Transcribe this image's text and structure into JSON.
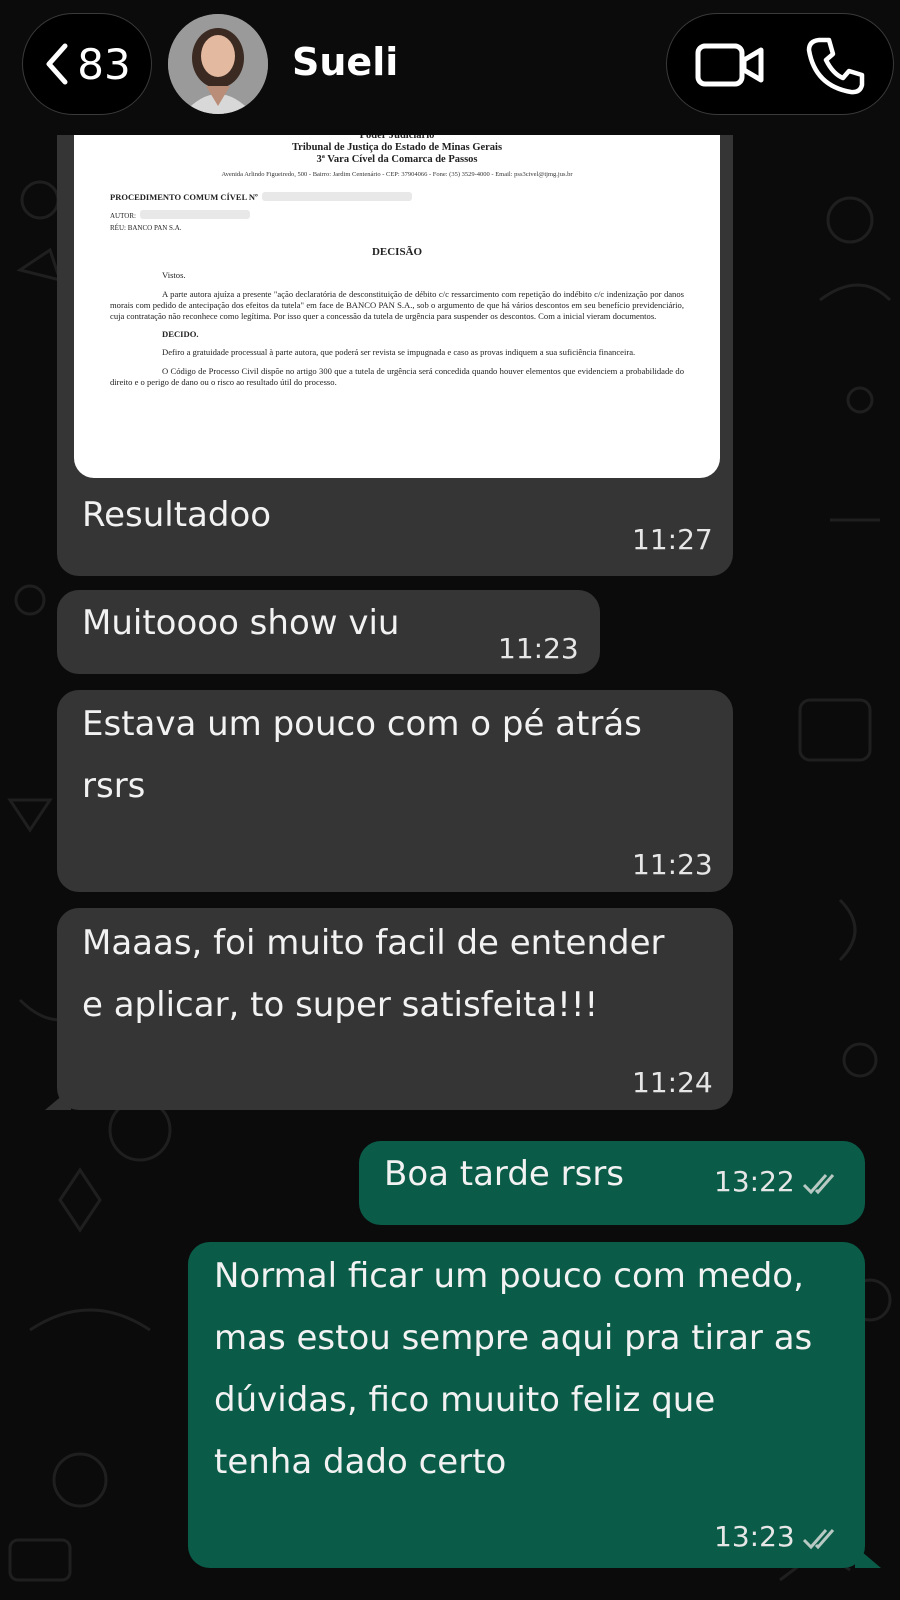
{
  "header": {
    "back_count": "83",
    "contact_name": "Sueli"
  },
  "document": {
    "line1": "Poder Judiciário",
    "line2": "Tribunal de Justiça do Estado de Minas Gerais",
    "line3": "3ª Vara Cível da Comarca de Passos",
    "address": "Avenida Arlindo Figueiredo, 500 - Bairro: Jardim Centenário - CEP: 37904066 - Fone: (35) 3529-4000 - Email: pss3civel@tjmg.jus.br",
    "procedure": "PROCEDIMENTO COMUM CÍVEL Nº",
    "author": "AUTOR:",
    "defendant": "RÉU: BANCO PAN S.A.",
    "title": "DECISÃO",
    "vistos": "Vistos.",
    "para1": "A parte autora ajuíza a presente \"ação declaratória de desconstituição de débito c/c ressarcimento com repetição do indébito c/c indenização por danos morais com pedido de antecipação dos efeitos da tutela\" em face de BANCO PAN S.A., sob o argumento de que há vários descontos em seu benefício previdenciário, cuja contratação não reconhece como legítima. Por isso quer a concessão da tutela de urgência para suspender os descontos. Com a inicial vieram documentos.",
    "decido": "DECIDO.",
    "para2": "Defiro a gratuidade processual à parte autora, que poderá ser revista se impugnada e caso as provas indiquem a sua suficiência financeira.",
    "para3": "O Código de Processo Civil dispõe no artigo 300 que a tutela de urgência será concedida quando houver elementos que evidenciem a probabilidade do direito e o perigo de dano ou o risco ao resultado útil do processo."
  },
  "messages": [
    {
      "direction": "in",
      "text": "Resultadoo",
      "time": "11:27"
    },
    {
      "direction": "in",
      "text": "Muitoooo show viu",
      "time": "11:23"
    },
    {
      "direction": "in",
      "text": "Estava um pouco com o pé atrás\nrsrs",
      "time": "11:23"
    },
    {
      "direction": "in",
      "text": "Maaas, foi muito facil de entender\ne aplicar, to super satisfeita!!!",
      "time": "11:24"
    },
    {
      "direction": "out",
      "text": "Boa tarde rsrs",
      "time": "13:22",
      "status": "read-double-check-icon"
    },
    {
      "direction": "out",
      "text": "Normal ficar um pouco com medo,\nmas estou sempre aqui pra tirar as\ndúvidas, fico muuito feliz que\ntenha dado certo",
      "time": "13:23",
      "status": "read-double-check-icon"
    }
  ],
  "colors": {
    "background": "#0b0b0b",
    "incoming_bubble": "#353535",
    "outgoing_bubble": "#0a5c48"
  }
}
